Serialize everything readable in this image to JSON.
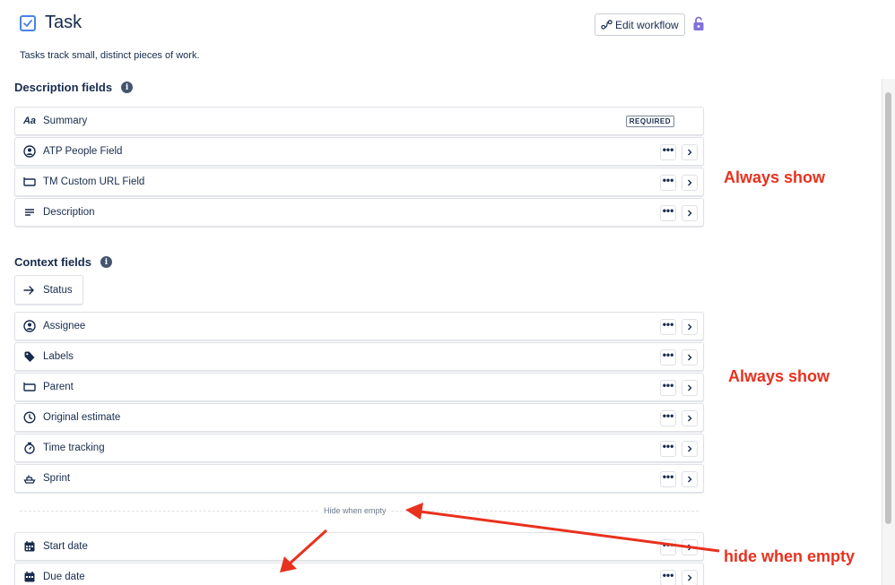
{
  "header": {
    "title": "Task",
    "edit_workflow_label": "Edit workflow",
    "description": "Tasks track small, distinct pieces of work."
  },
  "description_fields": {
    "title": "Description fields",
    "items": [
      {
        "label": "Summary",
        "icon": "text-aa-icon",
        "badge": "REQUIRED"
      },
      {
        "label": "ATP People Field",
        "icon": "person-icon"
      },
      {
        "label": "TM Custom URL Field",
        "icon": "field-icon"
      },
      {
        "label": "Description",
        "icon": "lines-icon"
      }
    ]
  },
  "context_fields": {
    "title": "Context fields",
    "status_label": "Status",
    "items": [
      {
        "label": "Assignee",
        "icon": "person-icon"
      },
      {
        "label": "Labels",
        "icon": "tag-icon"
      },
      {
        "label": "Parent",
        "icon": "field-icon"
      },
      {
        "label": "Original estimate",
        "icon": "clock-icon"
      },
      {
        "label": "Time tracking",
        "icon": "stopwatch-icon"
      },
      {
        "label": "Sprint",
        "icon": "sprint-icon"
      }
    ],
    "hide_when_empty_label": "Hide when empty",
    "hidden_items": [
      {
        "label": "Start date",
        "icon": "calendar-icon"
      },
      {
        "label": "Due date",
        "icon": "calendar-icon"
      }
    ]
  },
  "annotations": {
    "always_show_1": "Always show",
    "always_show_2": "Always show",
    "hide_when_empty": "hide when empty"
  },
  "more_glyph": "•••",
  "colors": {
    "accent": "#4b82e6",
    "annotation": "#e8311e",
    "lock": "#8270db"
  }
}
